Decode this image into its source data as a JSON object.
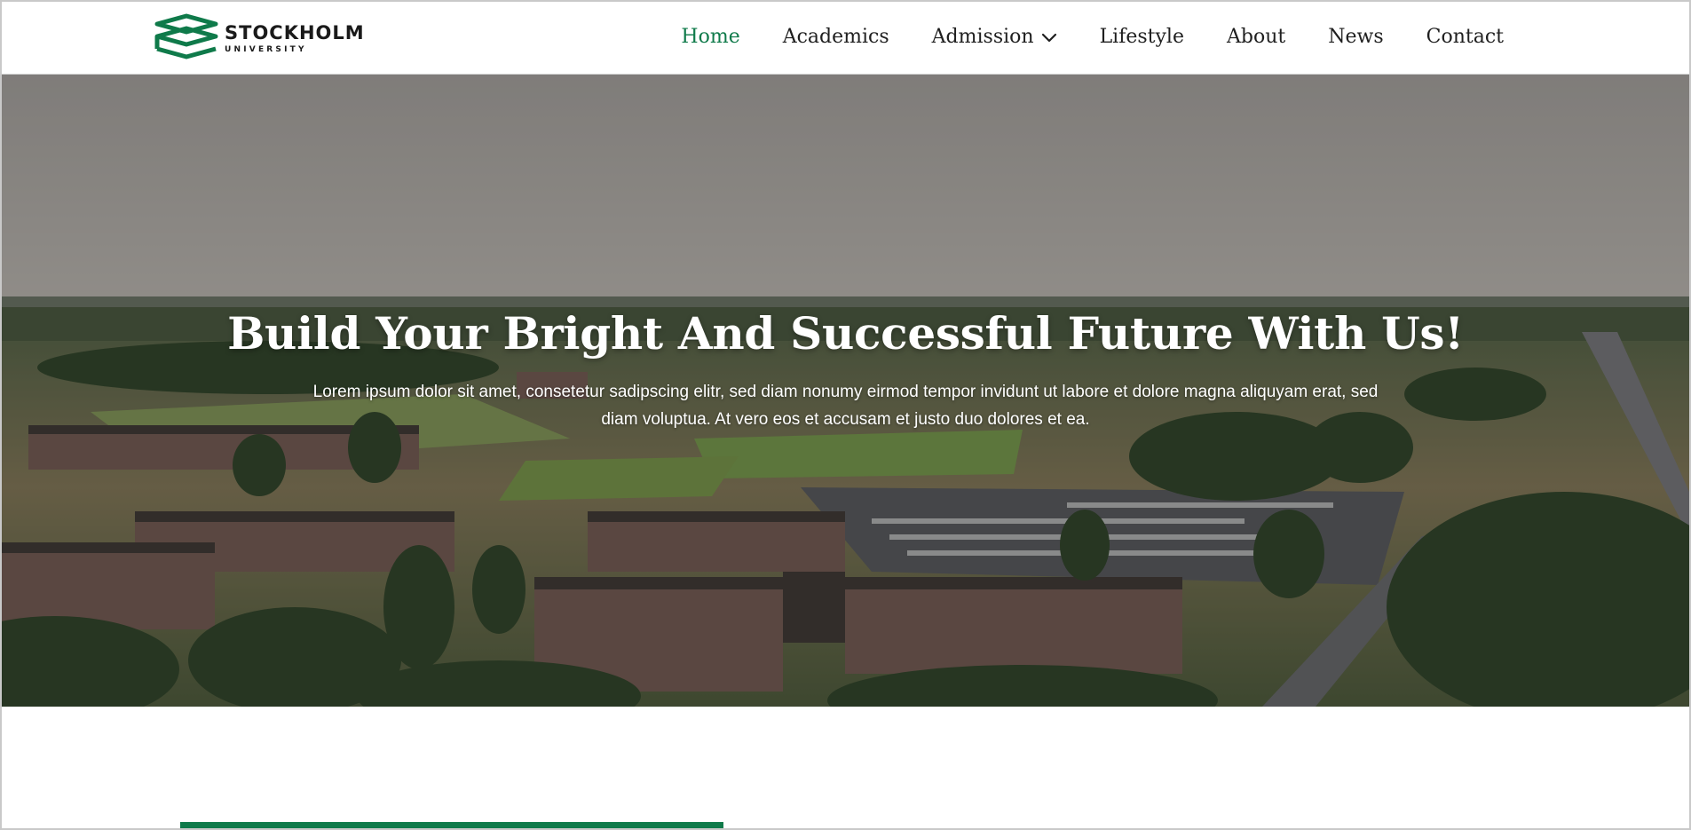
{
  "brand": {
    "name": "STOCKHOLM",
    "sub": "UNIVERSITY",
    "accent_color": "#0f7a4a"
  },
  "nav": {
    "items": [
      {
        "label": "Home",
        "active": true
      },
      {
        "label": "Academics"
      },
      {
        "label": "Admission",
        "has_dropdown": true
      },
      {
        "label": "Lifestyle"
      },
      {
        "label": "About"
      },
      {
        "label": "News"
      },
      {
        "label": "Contact"
      }
    ]
  },
  "hero": {
    "title": "Build Your Bright And Successful Future With Us!",
    "text": "Lorem ipsum dolor sit amet, consetetur sadipscing elitr, sed diam nonumy eirmod tempor invidunt ut labore et dolore magna aliquyam erat, sed diam voluptua. At vero eos et accusam et justo duo dolores et ea."
  }
}
